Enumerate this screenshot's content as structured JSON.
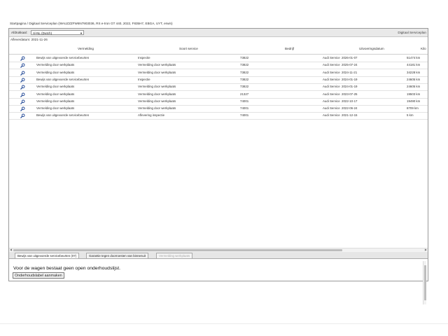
{
  "breadcrumb": "Startpagina / Digitaal Serviceplan (WAUZZZFW6N7903036, RS e-tron GT 440, 2022, F835H7, EBGA, UYT, erwin)",
  "toolbar": {
    "lang_label": "Afdrukkaal:",
    "lang_value": "nl-NL (Dutch)",
    "right_title": "Digitaal Serviceplan"
  },
  "delivery_date": "Afleverdatum: 2021-11-26",
  "table": {
    "columns": [
      "Vermelding",
      "Soort service",
      "Bedrijf",
      "Uitvoeringsdatum",
      "Kilo"
    ],
    "rows": [
      {
        "vermelding": "Bewijs van uitgevoerde servicebeurten",
        "soort": "Inspectie",
        "code": "73822",
        "bedrijf": "Audi Service",
        "datum": "2026-01-07",
        "km": "51474 km"
      },
      {
        "vermelding": "Vermelding door werkplaats",
        "soort": "Vermelding door werkplaats",
        "code": "73822",
        "bedrijf": "Audi Service",
        "datum": "2025-07-24",
        "km": "44181 km"
      },
      {
        "vermelding": "Vermelding door werkplaats",
        "soort": "Vermelding door werkplaats",
        "code": "73822",
        "bedrijf": "Audi Service",
        "datum": "2024-11-21",
        "km": "34228 km"
      },
      {
        "vermelding": "Bewijs van uitgevoerde servicebeurten",
        "soort": "Inspectie",
        "code": "73822",
        "bedrijf": "Audi Service",
        "datum": "2024-01-19",
        "km": "24605 km"
      },
      {
        "vermelding": "Vermelding door werkplaats",
        "soort": "Vermelding door werkplaats",
        "code": "73822",
        "bedrijf": "Audi Service",
        "datum": "2024-01-19",
        "km": "24605 km"
      },
      {
        "vermelding": "Vermelding door werkplaats",
        "soort": "Vermelding door werkplaats",
        "code": "21327",
        "bedrijf": "Audi Service",
        "datum": "2023-07-25",
        "km": "19503 km"
      },
      {
        "vermelding": "Vermelding door werkplaats",
        "soort": "Vermelding door werkplaats",
        "code": "74001",
        "bedrijf": "Audi Service",
        "datum": "2022-10-17",
        "km": "19490 km"
      },
      {
        "vermelding": "Vermelding door werkplaats",
        "soort": "Vermelding door werkplaats",
        "code": "74001",
        "bedrijf": "Audi Service",
        "datum": "2022-06-24",
        "km": "8709 km"
      },
      {
        "vermelding": "Bewijs van uitgevoerde servicebeurten",
        "soort": "Aflevering inspectie",
        "code": "74001",
        "bedrijf": "Audi Service",
        "datum": "2021-12-15",
        "km": "5 km"
      }
    ]
  },
  "row_icon": "magnifier-icon",
  "tabs": [
    {
      "label": "Bewijs van uitgevoerde servicebeurten (07)",
      "state": "active"
    },
    {
      "label": "Garantie tegen doorroesten van binnenuit",
      "state": "normal"
    },
    {
      "label": "Vermelding werkplaats",
      "state": "disabled"
    }
  ],
  "panel": {
    "message": "Voor de wagen bestaat geen open onderhoudslijst.",
    "button": "Onderhoudslabel aanmaken"
  },
  "colors": {
    "icon": "#2a4f9a",
    "border": "#9a9a9a"
  }
}
